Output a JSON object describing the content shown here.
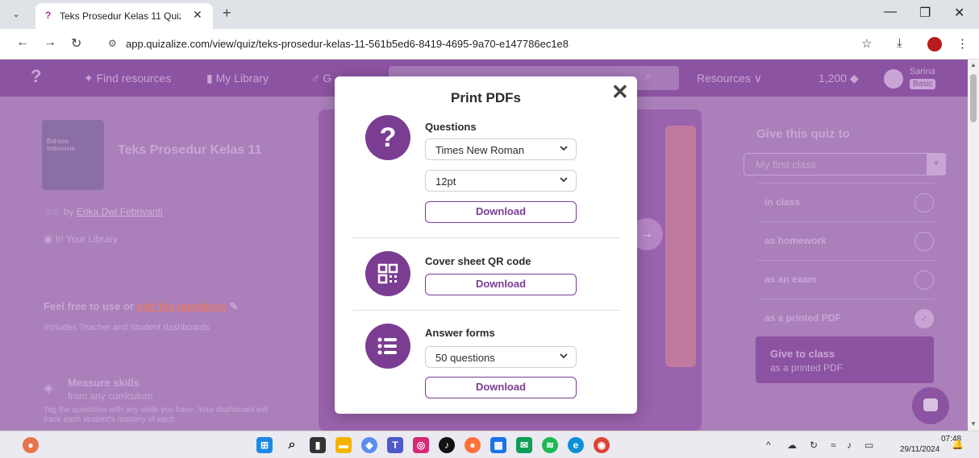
{
  "browser": {
    "tab_title": "Teks Prosedur Kelas 11 Quiz | Q",
    "url": "app.quizalize.com/view/quiz/teks-prosedur-kelas-11-561b5ed6-8419-4695-9a70-e147786ec1e8"
  },
  "site": {
    "nav": {
      "find_resources": "Find resources",
      "my_library": "My Library",
      "third_link": "G",
      "resources": "Resources",
      "coins": "1,200",
      "user_name": "Sarina",
      "user_plan": "Basic"
    },
    "quiz": {
      "cover_text": "Bahasa Indonesia",
      "title": "Teks Prosedur Kelas 11",
      "author_prefix": "by",
      "author": "Erika Dwi Febrivanti",
      "in_library": "In Your Library",
      "feel_free": "Feel free to use or",
      "edit_link": "edit the questions",
      "includes": "Includes Teacher and Student dashboards",
      "measure_title": "Measure skills",
      "measure_sub": "from any curriculum",
      "tag_text": "Tag the questions with any skills you have. Your dashboard will track each student's mastery of each"
    },
    "give": {
      "title": "Give this quiz to",
      "class_select": "My first class",
      "options": [
        "in class",
        "as homework",
        "as an exam",
        "as a printed PDF"
      ],
      "button_line1": "Give to class",
      "button_line2": "as a printed PDF"
    }
  },
  "modal": {
    "title": "Print PDFs",
    "questions": {
      "label": "Questions",
      "font": "Times New Roman",
      "size": "12pt",
      "download": "Download"
    },
    "cover": {
      "label": "Cover sheet QR code",
      "download": "Download"
    },
    "answers": {
      "label": "Answer forms",
      "count": "50 questions",
      "download": "Download"
    }
  },
  "taskbar": {
    "time": "07:48",
    "date": "29/11/2024"
  },
  "colors": {
    "brand_purple": "#7b3d92",
    "overlay_purple": "#ab7fba"
  }
}
